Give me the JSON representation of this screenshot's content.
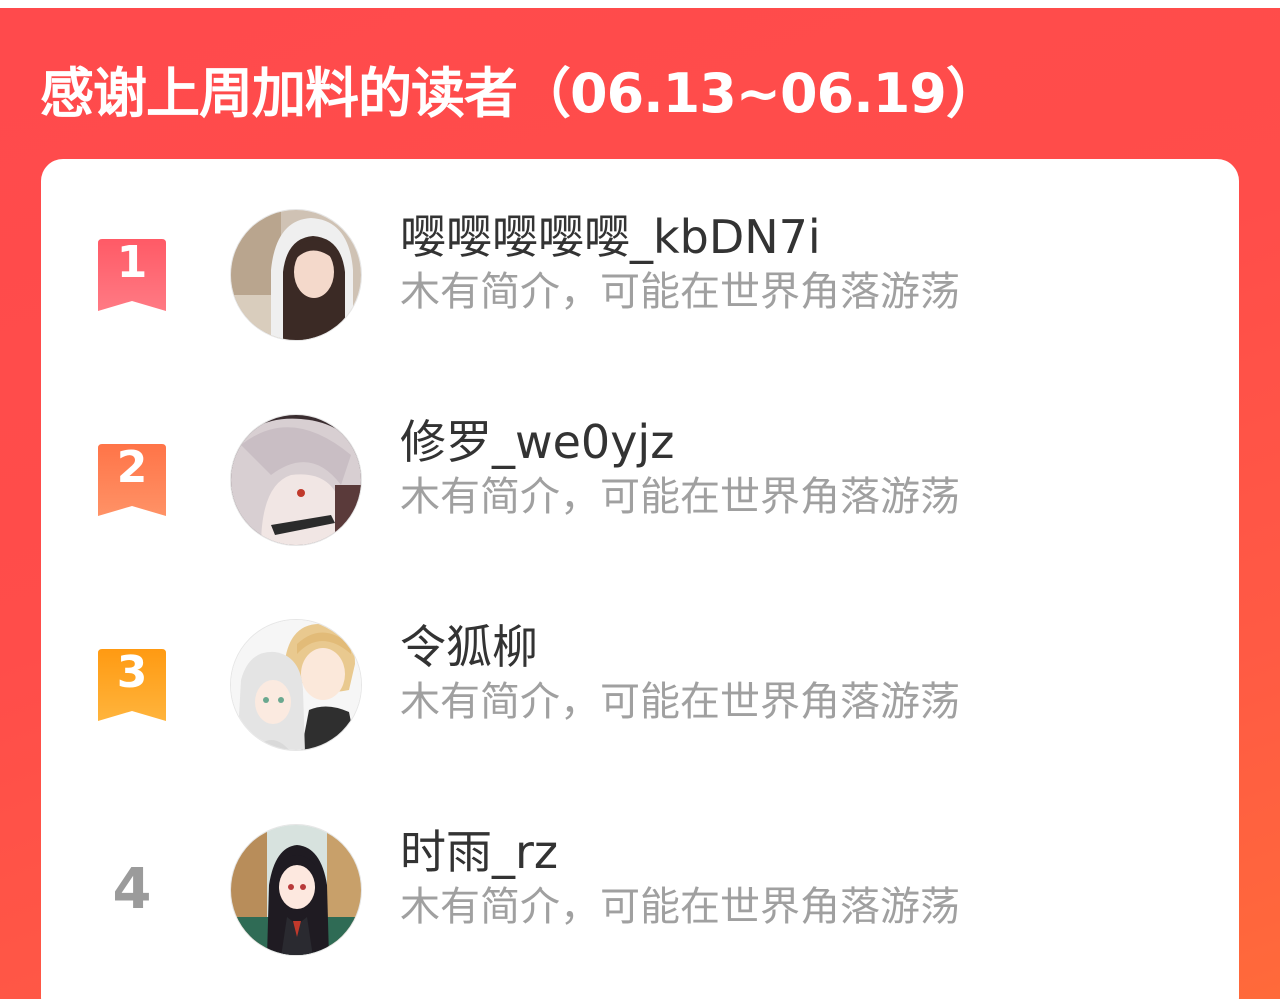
{
  "header": {
    "title": "感谢上周加料的读者（06.13~06.19）"
  },
  "colors": {
    "background_start": "#ff4a4c",
    "background_end": "#ff6a3a",
    "rank1": "#ff5f6a",
    "rank2": "#ff7a4e",
    "rank3": "#ffa21e",
    "rank_plain": "#9b9b9b"
  },
  "readers": [
    {
      "rank": "1",
      "name": "嘤嘤嘤嘤嘤_kbDN7i",
      "bio": "木有简介，可能在世界角落游荡"
    },
    {
      "rank": "2",
      "name": "修罗_we0yjz",
      "bio": "木有简介，可能在世界角落游荡"
    },
    {
      "rank": "3",
      "name": "令狐柳",
      "bio": "木有简介，可能在世界角落游荡"
    },
    {
      "rank": "4",
      "name": "时雨_rz",
      "bio": "木有简介，可能在世界角落游荡"
    }
  ]
}
